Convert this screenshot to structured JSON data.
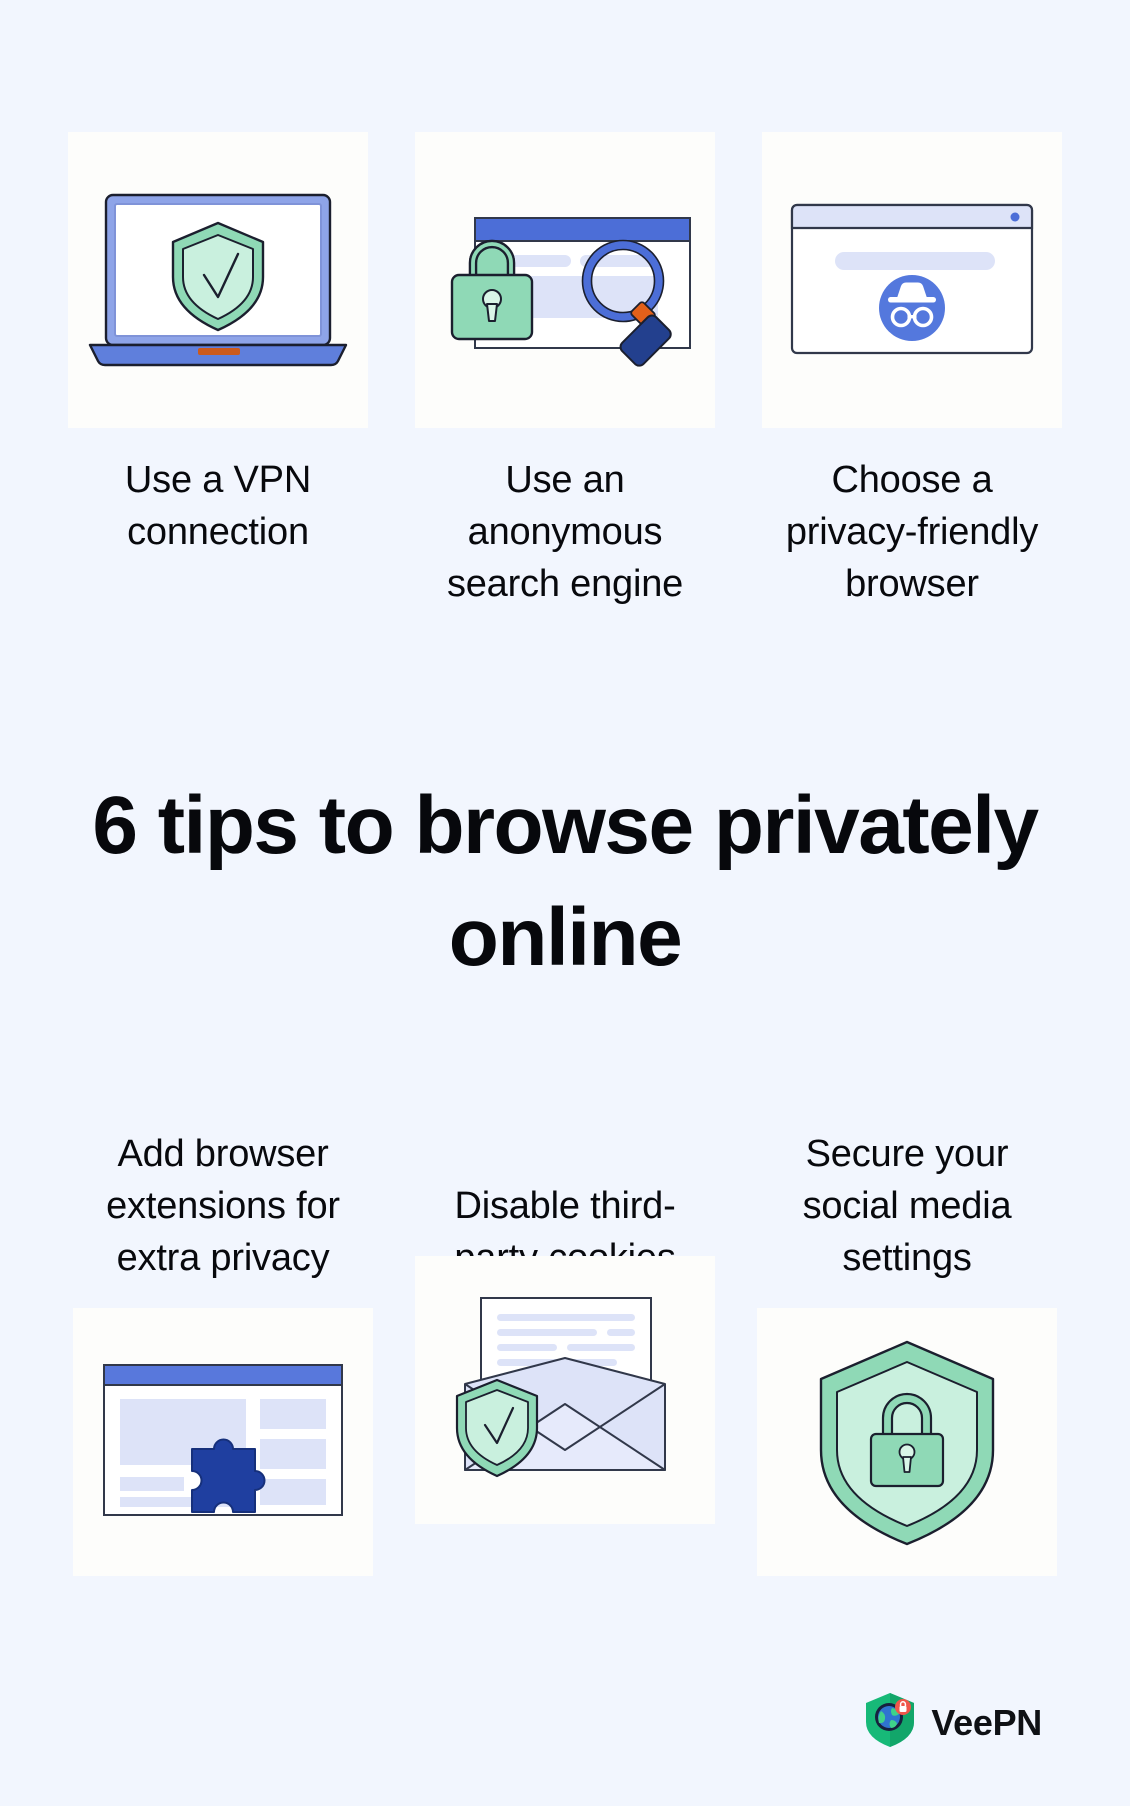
{
  "background_color": "#f2f6fe",
  "headline": "6 tips to browse privately online",
  "top_tips": [
    {
      "label": "Use a VPN connection",
      "illustration": "laptop-with-shield-check-icon"
    },
    {
      "label": "Use an anonymous search engine",
      "illustration": "browser-with-padlock-and-magnifier-icon"
    },
    {
      "label": "Choose a privacy-friendly browser",
      "illustration": "browser-with-incognito-icon"
    }
  ],
  "bottom_tips": [
    {
      "label": "Add browser extensions for extra privacy",
      "illustration": "browser-with-puzzle-piece-icon"
    },
    {
      "label": "Disable third-party cookies",
      "illustration": "envelope-with-letter-and-shield-icon"
    },
    {
      "label": "Secure your social media settings",
      "illustration": "shield-with-padlock-icon"
    }
  ],
  "brand": {
    "name": "VeePN",
    "logo": "veepn-shield-globe-lock-logo"
  },
  "colors": {
    "background": "#f2f6fe",
    "card": "#fdfdfb",
    "text": "#08090d",
    "blue": "#4c6ed7",
    "blue_dark": "#1e40af",
    "blue_light": "#dde3f8",
    "green": "#8fd9b6",
    "green_light": "#c9f0de",
    "green_dark": "#6bc79b",
    "orange": "#e2601a",
    "outline": "#1b1f2e",
    "logo_green": "#17b978",
    "logo_globe_blue": "#2f74d0",
    "logo_lock_red": "#f0564a"
  }
}
